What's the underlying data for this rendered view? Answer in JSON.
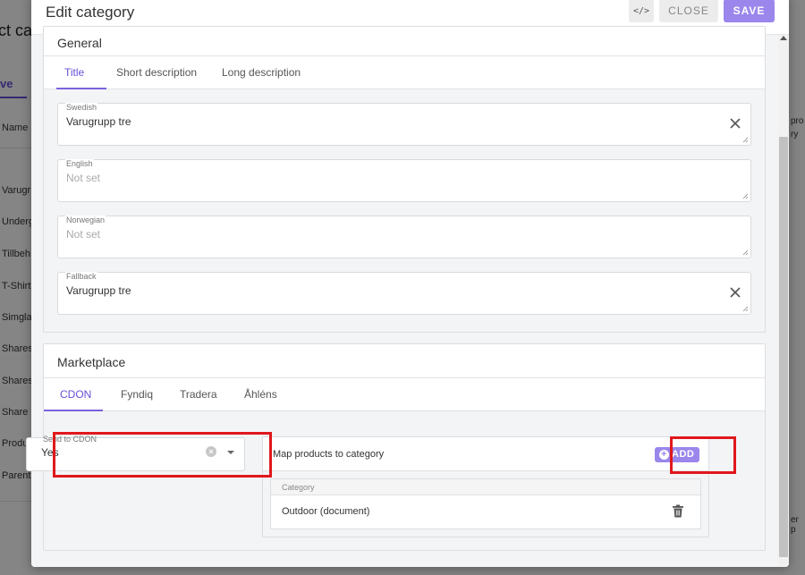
{
  "background": {
    "title": "ct ca",
    "tab": "ve",
    "name_header": "Name",
    "rows": [
      "Varugr",
      "Underg",
      "Tillbeh",
      "T-Shirt",
      "Simgla",
      "Shares",
      "Shares",
      "Share",
      "Produk",
      "Parent"
    ],
    "right_col_1": "pro",
    "right_col_2": "ry",
    "right_bottom": "er p"
  },
  "modal": {
    "title": "Edit category",
    "code_button_icon": "code-icon",
    "code_button_glyph": "</>",
    "close_label": "CLOSE",
    "save_label": "SAVE"
  },
  "general": {
    "title": "General",
    "tabs": [
      "Title",
      "Short description",
      "Long description"
    ],
    "active_tab": "Title",
    "fields": [
      {
        "label": "Swedish",
        "value": "Varugrupp tre",
        "placeholder": ""
      },
      {
        "label": "English",
        "value": "",
        "placeholder": "Not set"
      },
      {
        "label": "Norwegian",
        "value": "",
        "placeholder": "Not set"
      },
      {
        "label": "Fallback",
        "value": "Varugrupp tre",
        "placeholder": ""
      }
    ]
  },
  "marketplace": {
    "title": "Marketplace",
    "tabs": [
      "CDON",
      "Fyndiq",
      "Tradera",
      "Åhléns"
    ],
    "active_tab": "CDON",
    "send_select": {
      "label": "Send to CDON",
      "value": "Yes"
    },
    "map": {
      "title": "Map products to category",
      "add_label": "ADD",
      "column": "Category",
      "rows": [
        "Outdoor (document)"
      ]
    }
  },
  "colors": {
    "accent": "#7b62e0",
    "button_primary": "#9b86ec",
    "highlight": "#e0181c"
  }
}
